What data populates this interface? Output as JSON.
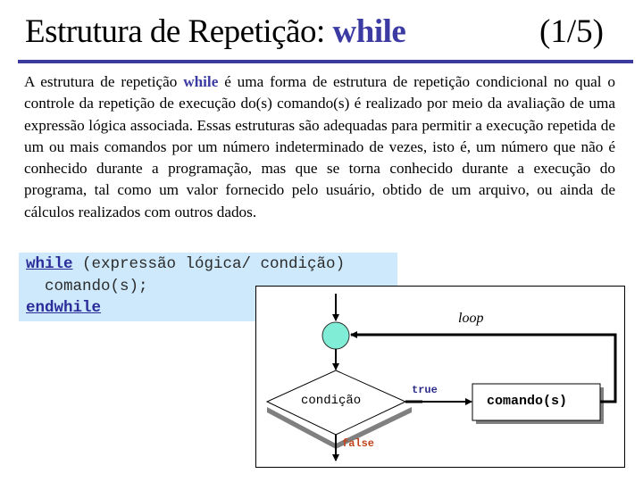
{
  "slide": {
    "title_prefix": "Estrutura de Repetição: ",
    "title_keyword": "while",
    "page_counter": "(1/5)",
    "accent_color": "#3b3b9f"
  },
  "paragraph": {
    "part1": "A estrutura de repetição ",
    "keyword": "while",
    "part2": " é uma forma de estrutura de repetição condicional no qual o controle da repetição de execução do(s) comando(s) é realizado por meio da avaliação de uma expressão lógica associada. Essas estruturas são adequadas para permitir a execução repetida de um ou mais comandos por um número indeterminado de vezes, isto é, um número que não é conhecido durante a programação, mas que se torna conhecido durante a execução do programa, tal como um valor fornecido pelo usuário, obtido de um arquivo, ou ainda de cálculos realizados com outros dados."
  },
  "code": {
    "line1_keyword": "while",
    "line1_rest": " (expressão lógica/ condição)",
    "line2": "  comando(s);",
    "line3_keyword": "endwhile"
  },
  "flowchart": {
    "loop_label": "loop",
    "condition_label": "condição",
    "true_label": "true",
    "false_label": "false",
    "command_label": "comando(s)",
    "junction_color": "#80eed6",
    "true_color": "#2b2b8a",
    "false_color": "#c0441a"
  }
}
